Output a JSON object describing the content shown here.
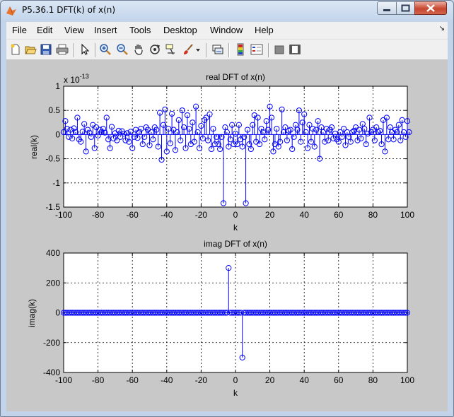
{
  "window": {
    "title": "P5.36.1 DFT(k) of x(n)"
  },
  "menu": [
    "File",
    "Edit",
    "View",
    "Insert",
    "Tools",
    "Desktop",
    "Window",
    "Help"
  ],
  "toolbar": [
    "new-figure-icon",
    "open-file-icon",
    "save-icon",
    "print-icon",
    "pointer-icon",
    "zoom-in-icon",
    "zoom-out-icon",
    "pan-hand-icon",
    "rotate-3d-icon",
    "data-cursor-icon",
    "brush-icon",
    "brush-dropdown-icon",
    "link-plot-icon",
    "colorbar-icon",
    "legend-icon",
    "hide-plot-tools-icon",
    "show-plot-tools-icon"
  ],
  "chart_data": [
    {
      "type": "stem",
      "title": "real DFT of x(n)",
      "xlabel": "k",
      "ylabel": "real(k)",
      "exponent_label": "x 10",
      "exponent_power": "-13",
      "xlim": [
        -100,
        100
      ],
      "ylim": [
        -1.5,
        1
      ],
      "xticks": [
        "-100",
        "-80",
        "-60",
        "-40",
        "-20",
        "0",
        "20",
        "40",
        "60",
        "80",
        "100"
      ],
      "yticks": [
        "1",
        "0.5",
        "0",
        "-0.5",
        "-1",
        "-1.5"
      ],
      "ytick_values": [
        1,
        0.5,
        0,
        -0.5,
        -1,
        -1.5
      ],
      "grid": true,
      "x_start": -100,
      "y": [
        0.05,
        0.28,
        0.12,
        -0.05,
        0.1,
        -0.08,
        0.13,
        0.05,
        0.35,
        -0.1,
        -0.15,
        0.06,
        0.22,
        -0.35,
        0.1,
        0.04,
        -0.05,
        0.2,
        -0.28,
        0.15,
        -0.02,
        0.1,
        0.05,
        0.12,
        0.04,
        0.35,
        -0.1,
        -0.28,
        0.16,
        -0.08,
        0.03,
        -0.12,
        0.08,
        -0.05,
        0.07,
        0.02,
        -0.12,
        0.03,
        -0.15,
        0.06,
        -0.28,
        -0.05,
        0.1,
        -0.07,
        0.05,
        0.12,
        -0.2,
        -0.05,
        0.15,
        0.1,
        -0.22,
        0.05,
        -0.1,
        0.15,
        0.1,
        -0.25,
        0.45,
        -0.52,
        0.2,
        0.52,
        -0.35,
        0.12,
        -0.18,
        0.43,
        0.1,
        -0.32,
        0.05,
        0.3,
        -0.12,
        0.5,
        0.15,
        -0.28,
        0.4,
        0.12,
        -0.2,
        0.25,
        -0.15,
        0.58,
        0.05,
        -0.28,
        0.18,
        -0.08,
        0.3,
        0.35,
        -0.12,
        0.42,
        -0.3,
        0.12,
        -0.2,
        -0.05,
        -0.2,
        -0.3,
        -0.05,
        -1.42,
        0.15,
        0.05,
        -0.25,
        -0.1,
        0.2,
        -0.2,
        0.02,
        -0.2,
        0.2,
        -0.1,
        -0.25,
        -0.05,
        -1.42,
        0.1,
        -0.2,
        -0.3,
        0.2,
        0.4,
        -0.15,
        0.35,
        -0.2,
        0.12,
        0.05,
        -0.1,
        0.28,
        0.1,
        0.58,
        0.35,
        -0.35,
        -0.2,
        0.12,
        -0.25,
        -0.15,
        0.52,
        0.05,
        0.15,
        -0.12,
        0.08,
        0.1,
        -0.3,
        -0.05,
        0.2,
        0.1,
        0.5,
        -0.15,
        0.25,
        0.42,
        0.05,
        -0.28,
        0.2,
        -0.15,
        0.12,
        -0.25,
        0.1,
        0.28,
        -0.5,
        0.15,
        0.05,
        -0.15,
        0.12,
        -0.12,
        0.1,
        0.15,
        -0.08,
        0.02,
        -0.1,
        -0.15,
        0.05,
        -0.05,
        0.12,
        -0.22,
        0.05,
        -0.05,
        -0.15,
        0.05,
        0.08,
        0.15,
        -0.12,
        0.1,
        -0.08,
        0.22,
        0.12,
        -0.2,
        0.02,
        0.35,
        0.05,
        0.1,
        -0.12,
        0.15,
        0.05,
        0.08,
        -0.2,
        0.3,
        -0.35,
        0.35,
        -0.1,
        0.15,
        0.05,
        -0.1,
        0.1,
        0.05,
        0.2,
        -0.12,
        0.3,
        0.05,
        -0.05,
        0.28,
        0.05
      ]
    },
    {
      "type": "stem",
      "title": "imag DFT of x(n)",
      "xlabel": "k",
      "ylabel": "imag(k)",
      "xlim": [
        -100,
        100
      ],
      "ylim": [
        -400,
        400
      ],
      "xticks": [
        "-100",
        "-80",
        "-60",
        "-40",
        "-20",
        "0",
        "20",
        "40",
        "60",
        "80",
        "100"
      ],
      "yticks": [
        "400",
        "200",
        "0",
        "-200",
        "-400"
      ],
      "ytick_values": [
        400,
        200,
        0,
        -200,
        -400
      ],
      "grid": true,
      "x_start": -100,
      "x_count": 201,
      "nonzero": [
        {
          "k": -4,
          "value": 300
        },
        {
          "k": 4,
          "value": -300
        }
      ]
    }
  ]
}
